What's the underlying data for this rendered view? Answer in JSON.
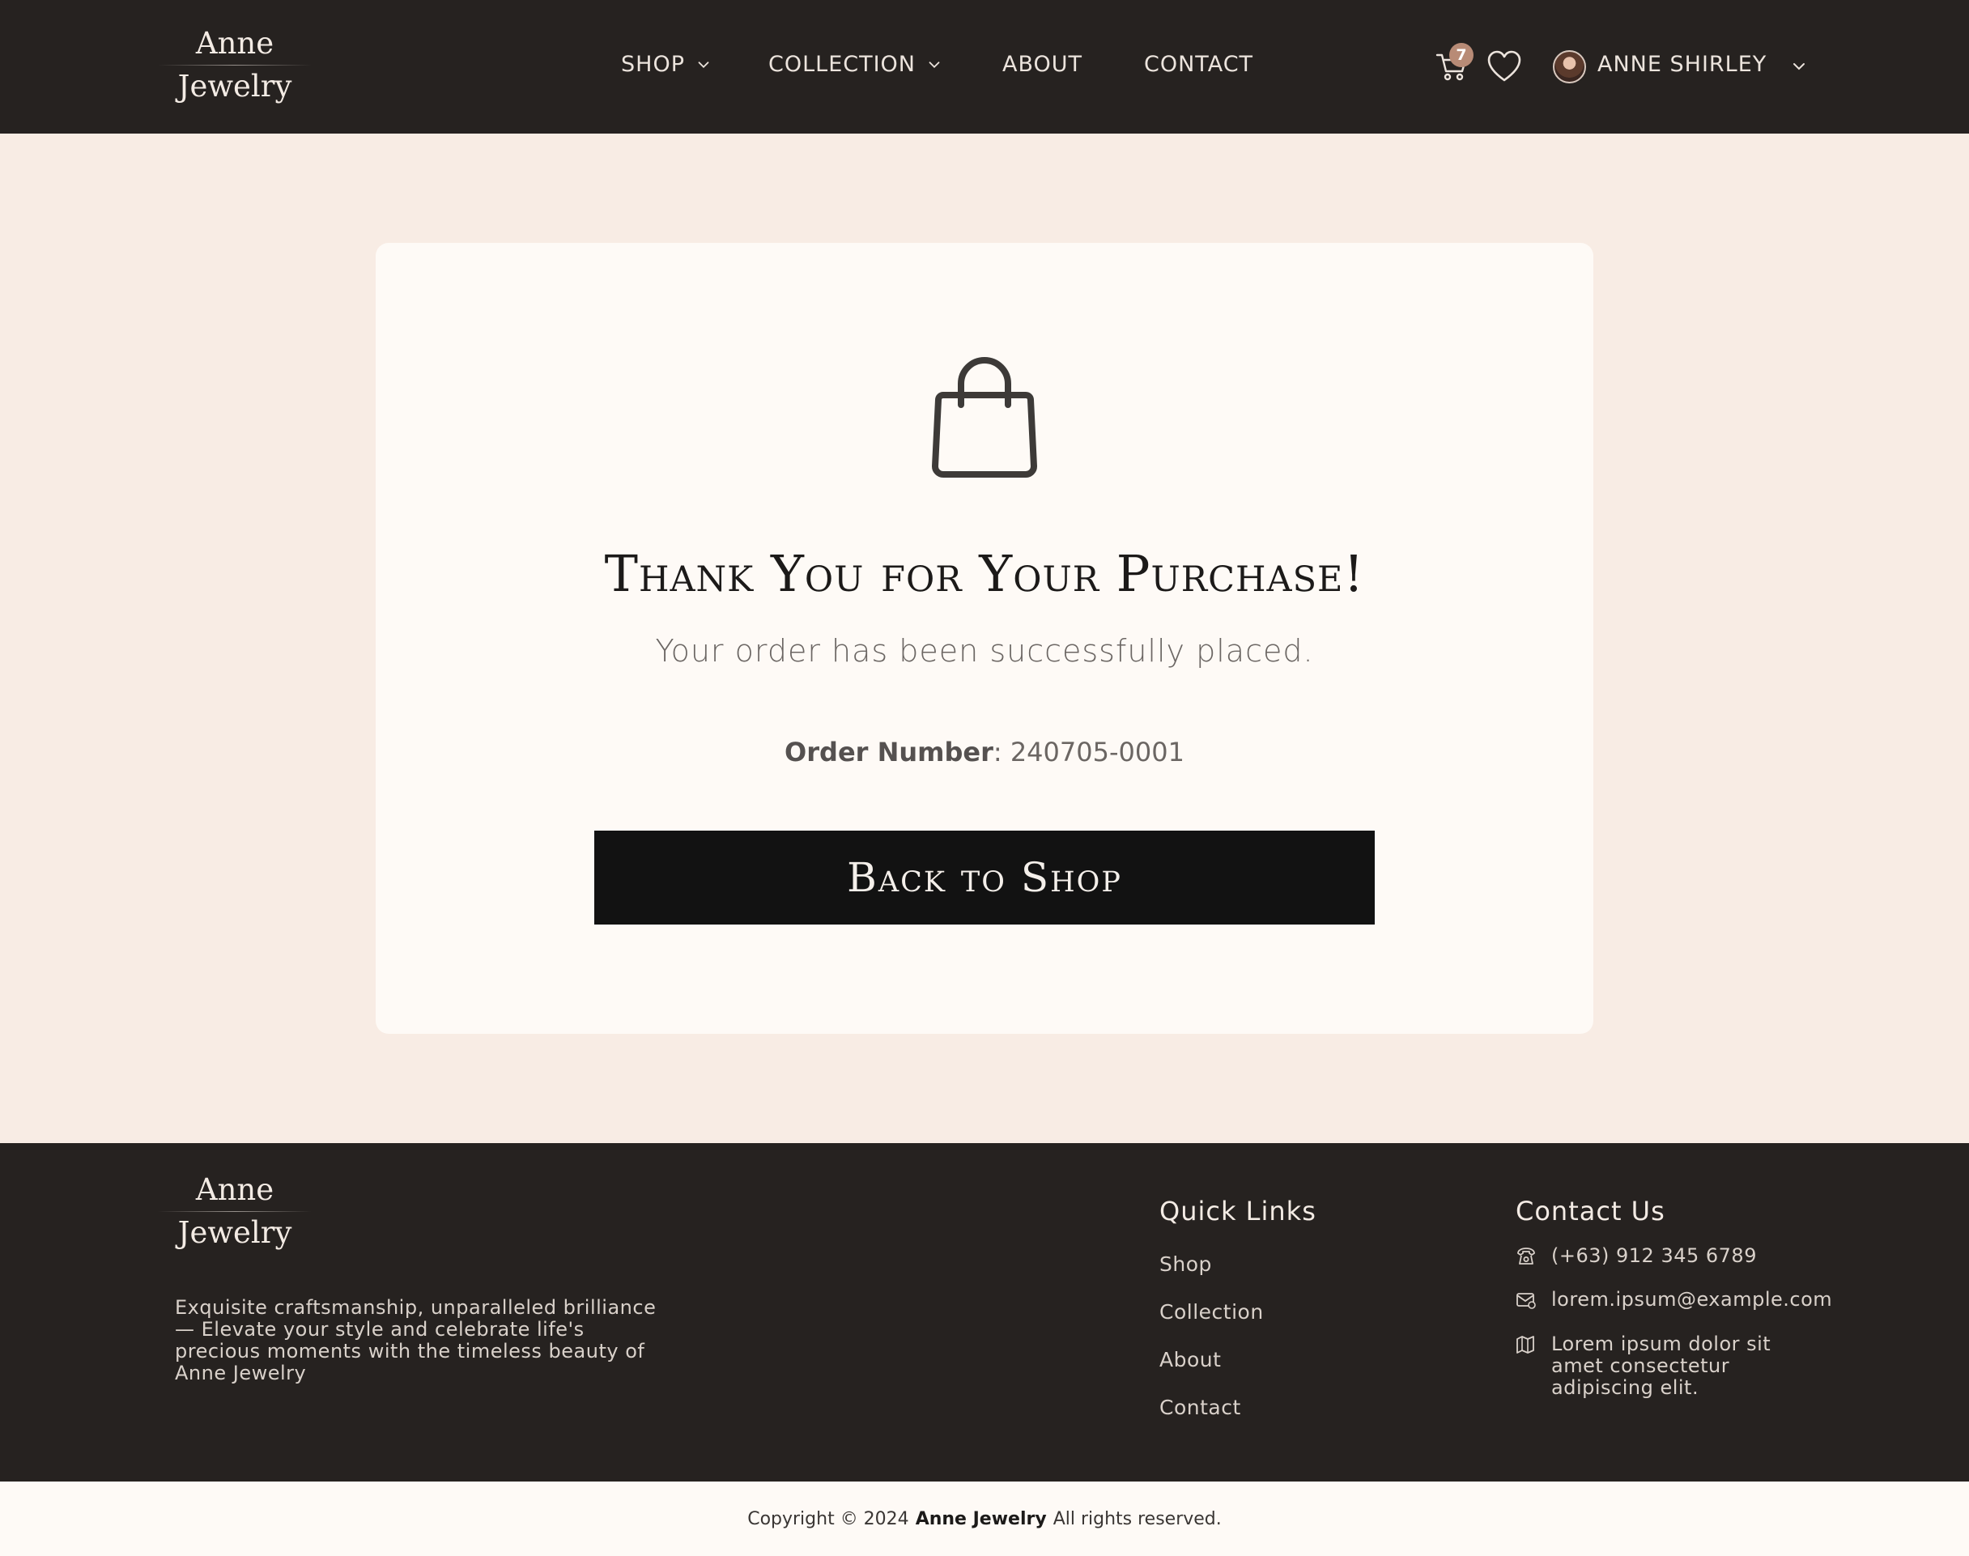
{
  "brand": {
    "line1": "Anne",
    "line2": "Jewelry"
  },
  "nav": {
    "shop": "SHOP",
    "collection": "COLLECTION",
    "about": "ABOUT",
    "contact": "CONTACT"
  },
  "header": {
    "cart_count": "7",
    "user_name": "ANNE SHIRLEY"
  },
  "main": {
    "title": "Thank You for Your Purchase!",
    "subtitle": "Your order has been successfully placed.",
    "order_label": "Order Number",
    "order_sep": ": ",
    "order_number": "240705-0001",
    "button_label": "Back to Shop"
  },
  "footer": {
    "tagline": "Exquisite craftsmanship, unparalleled brilliance — Elevate your style and celebrate life's precious moments with the timeless beauty of Anne Jewelry",
    "quick_links_heading": "Quick Links",
    "quick_links": [
      "Shop",
      "Collection",
      "About",
      "Contact"
    ],
    "contact_heading": "Contact Us",
    "phone": "(+63) 912 345 6789",
    "email": "lorem.ipsum@example.com",
    "address": "Lorem ipsum dolor sit amet consectetur adipiscing elit."
  },
  "copyright": {
    "prefix": "Copyright © 2024",
    "brand": "Anne Jewelry",
    "suffix": "All rights reserved."
  },
  "icons": {
    "cart": "shopping-cart-icon",
    "wishlist": "heart-icon",
    "bag": "shopping-bag-icon",
    "phone": "phone-icon",
    "email": "mail-icon",
    "address": "map-icon"
  },
  "colors": {
    "header_bg": "#262220",
    "page_bg": "#f8ece4",
    "card_bg": "#fefaf6",
    "button_bg": "#121212",
    "badge": "#b88b76"
  }
}
